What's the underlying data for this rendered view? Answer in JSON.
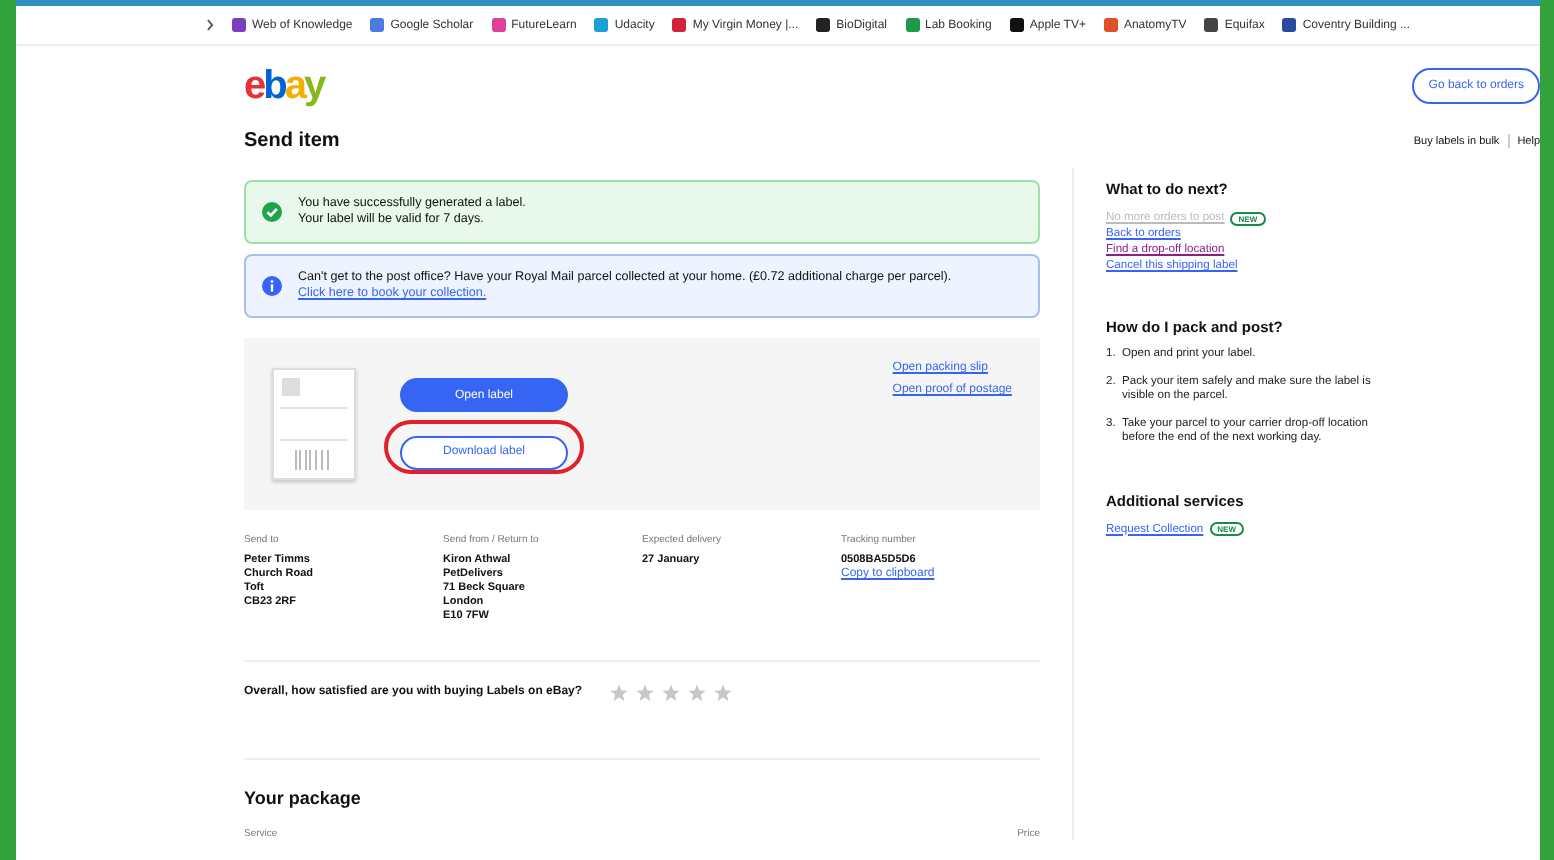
{
  "bookmarks": [
    {
      "label": "Web of Knowledge",
      "color": "#7b3fc4"
    },
    {
      "label": "Google Scholar",
      "color": "#4a7be0"
    },
    {
      "label": "FutureLearn",
      "color": "#e0409a"
    },
    {
      "label": "Udacity",
      "color": "#1ca0d8"
    },
    {
      "label": "My Virgin Money |...",
      "color": "#d0243a"
    },
    {
      "label": "BioDigital",
      "color": "#222222"
    },
    {
      "label": "Lab Booking",
      "color": "#1f9a4a"
    },
    {
      "label": "Apple TV+",
      "color": "#111111"
    },
    {
      "label": "AnatomyTV",
      "color": "#e0502a"
    },
    {
      "label": "Equifax",
      "color": "#444444"
    },
    {
      "label": "Coventry Building ...",
      "color": "#2a4aa0"
    }
  ],
  "header": {
    "logo": "ebay",
    "back_button": "Go back to orders"
  },
  "title": "Send item",
  "top_links": [
    "Buy labels in bulk",
    "Help"
  ],
  "alerts": [
    {
      "kind": "success",
      "lines": [
        "You have successfully generated a label.",
        "Your label will be valid for 7 days."
      ]
    },
    {
      "kind": "info",
      "lines": [
        "Can't get to the post office? Have your Royal Mail parcel collected at your home. (£0.72 additional charge per parcel)."
      ],
      "link": "Click here to book your collection."
    }
  ],
  "label_panel": {
    "open_button": "Open label",
    "download_button": {
      "label": "Download label",
      "highlighted": true
    },
    "links": [
      "Open packing slip",
      "Open proof of postage"
    ]
  },
  "details": [
    {
      "heading": "Send to",
      "lines": [
        "Peter Timms",
        "Church Road",
        "Toft",
        "CB23 2RF"
      ]
    },
    {
      "heading": "Send from / Return to",
      "lines": [
        "Kiron Athwal",
        "PetDelivers",
        "71 Beck Square",
        "London",
        "E10 7FW"
      ]
    },
    {
      "heading": "Expected delivery",
      "lines": [
        "27 January"
      ]
    },
    {
      "heading": "Tracking number",
      "lines": [
        "0508BA5D5D6"
      ],
      "link": "Copy to clipboard"
    }
  ],
  "rating": {
    "question": "Overall, how satisfied are you with buying Labels on eBay?",
    "stars": 0
  },
  "package": {
    "title": "Your package",
    "columns": [
      "Service",
      "Price"
    ]
  },
  "sidebar": {
    "next": {
      "title": "What to do next?",
      "links": [
        {
          "text": "No more orders to post",
          "disabled": true,
          "visited": false,
          "badge": "NEW"
        },
        {
          "text": "Back to orders",
          "disabled": false,
          "visited": false
        },
        {
          "text": "Find a drop-off location",
          "disabled": false,
          "visited": true
        },
        {
          "text": "Cancel this shipping label",
          "disabled": false,
          "visited": false
        }
      ]
    },
    "how": {
      "title": "How do I pack and post?",
      "steps": [
        {
          "number": "1.",
          "text": "Open and print your label."
        },
        {
          "number": "2.",
          "text": "Pack your item safely and make sure the label is visible on the parcel."
        },
        {
          "number": "3.",
          "text": "Take your parcel to your carrier drop-off location before the end of the next working day."
        }
      ]
    },
    "services": {
      "title": "Additional services",
      "links": [
        {
          "text": "Request Collection",
          "disabled": false,
          "visited": false,
          "badge": "NEW"
        }
      ]
    }
  }
}
